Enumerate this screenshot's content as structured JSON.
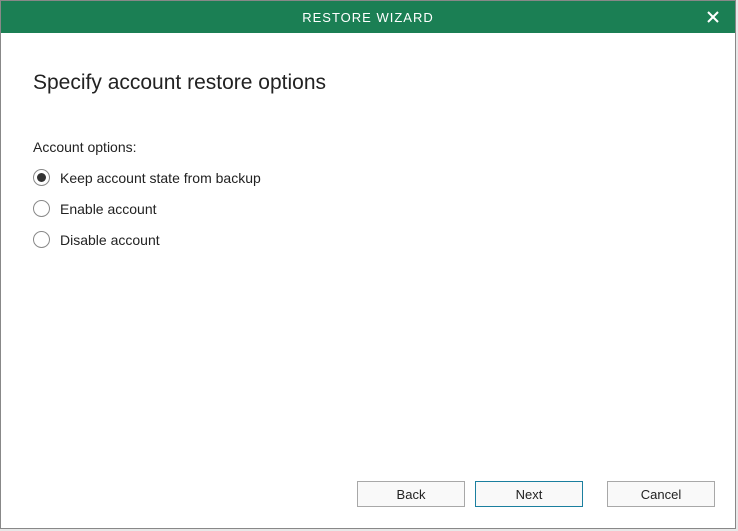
{
  "titlebar": {
    "title": "RESTORE WIZARD"
  },
  "page": {
    "heading": "Specify account restore options",
    "section_label": "Account options:"
  },
  "radios": {
    "options": [
      {
        "label": "Keep account state from backup",
        "selected": true
      },
      {
        "label": "Enable account",
        "selected": false
      },
      {
        "label": "Disable account",
        "selected": false
      }
    ]
  },
  "buttons": {
    "back": "Back",
    "next": "Next",
    "cancel": "Cancel"
  }
}
